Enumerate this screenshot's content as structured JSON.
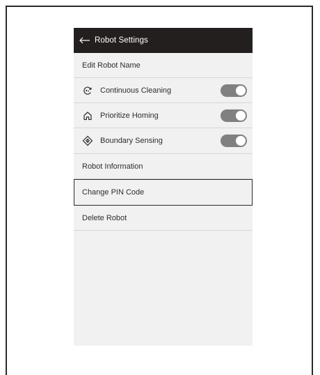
{
  "header": {
    "title": "Robot Settings"
  },
  "rows": {
    "edit_name": {
      "label": "Edit Robot Name"
    },
    "continuous_cleaning": {
      "label": "Continuous Cleaning",
      "enabled": true
    },
    "prioritize_homing": {
      "label": "Prioritize Homing",
      "enabled": true
    },
    "boundary_sensing": {
      "label": "Boundary Sensing",
      "enabled": true
    },
    "robot_information": {
      "label": "Robot Information"
    },
    "change_pin": {
      "label": "Change PIN Code",
      "highlighted": true
    },
    "delete_robot": {
      "label": "Delete Robot"
    }
  },
  "colors": {
    "header_bg": "#231f1e",
    "screen_bg": "#f1f1f1",
    "toggle_on": "#808080"
  },
  "icons": {
    "back": "arrow-left-icon",
    "continuous_cleaning": "continuous-cleaning-icon",
    "prioritize_homing": "home-icon",
    "boundary_sensing": "boundary-sensing-icon"
  }
}
